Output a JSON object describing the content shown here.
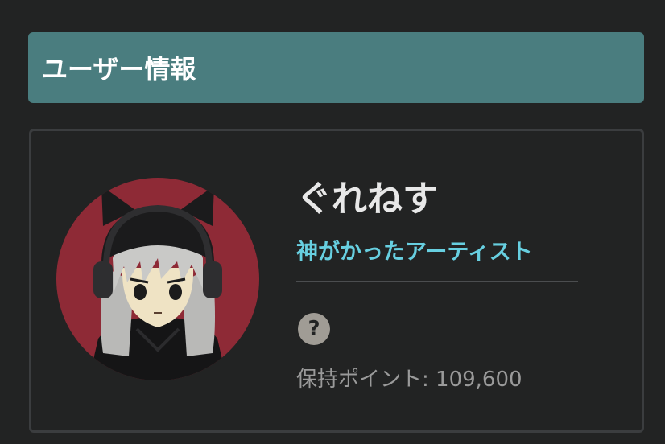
{
  "header": {
    "title": "ユーザー情報"
  },
  "profile": {
    "name": "ぐれねす",
    "title": "神がかったアーティスト",
    "help_icon_glyph": "?",
    "points_label": "保持ポイント: ",
    "points_value": "109,600",
    "accent_color": "#67cfe0",
    "header_color": "#4a7d7f",
    "avatar_bg_color": "#8e2a36"
  }
}
